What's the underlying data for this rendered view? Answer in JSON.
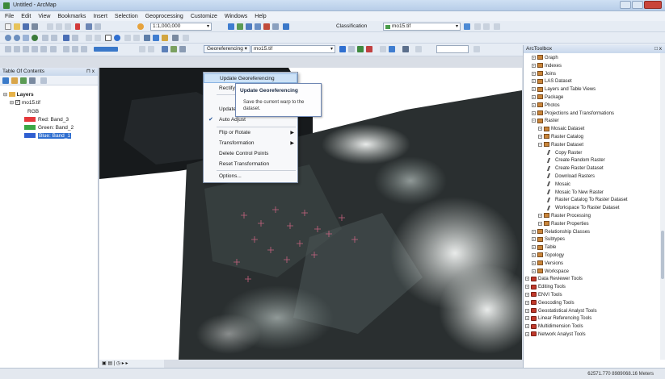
{
  "window": {
    "title": "Untitled - ArcMap"
  },
  "menu": [
    "File",
    "Edit",
    "View",
    "Bookmarks",
    "Insert",
    "Selection",
    "Geoprocessing",
    "Customize",
    "Windows",
    "Help"
  ],
  "standard_toolbar": {
    "scale": "1:1,000,000",
    "classification_label": "Classification",
    "classification_layer": "mo15.tif"
  },
  "georef_toolbar": {
    "menu_label": "Georeferencing",
    "layer": "mo15.tif"
  },
  "toc": {
    "title": "Table Of Contents",
    "layers_label": "Layers",
    "layer_name": "mo15.tif",
    "rgb_label": "RGB",
    "bands": [
      {
        "label": "Red:  Band_3",
        "color": "#e5383b"
      },
      {
        "label": "Green: Band_2",
        "color": "#3aa845"
      },
      {
        "label": "Blue:  Band_1",
        "color": "#2f5fd1"
      }
    ]
  },
  "georef_menu": {
    "items": [
      {
        "label": "Update Georeferencing",
        "highlighted": true
      },
      {
        "label": "Rectify..."
      },
      {
        "label": "Update"
      },
      {
        "label": "Auto Adjust",
        "checked": true
      },
      {
        "label": "Flip or Rotate",
        "submenu": true
      },
      {
        "label": "Transformation",
        "submenu": true
      },
      {
        "label": "Delete Control Points"
      },
      {
        "label": "Reset Transformation"
      },
      {
        "label": "Options..."
      }
    ],
    "tooltip": {
      "title": "Update Georeferencing",
      "body": "Save the current warp to the dataset."
    }
  },
  "toolbox": {
    "title": "ArcToolbox",
    "rows": [
      {
        "label": "Graph",
        "kind": "toolset",
        "level": 1
      },
      {
        "label": "Indexes",
        "kind": "toolset",
        "level": 1
      },
      {
        "label": "Joins",
        "kind": "toolset",
        "level": 1
      },
      {
        "label": "LAS Dataset",
        "kind": "toolset",
        "level": 1
      },
      {
        "label": "Layers and Table Views",
        "kind": "toolset",
        "level": 1
      },
      {
        "label": "Package",
        "kind": "toolset",
        "level": 1
      },
      {
        "label": "Photos",
        "kind": "toolset",
        "level": 1
      },
      {
        "label": "Projections and Transformations",
        "kind": "toolset",
        "level": 1
      },
      {
        "label": "Raster",
        "kind": "toolset",
        "level": 1,
        "expanded": true
      },
      {
        "label": "Mosaic Dataset",
        "kind": "toolset",
        "level": 2
      },
      {
        "label": "Raster Catalog",
        "kind": "toolset",
        "level": 2
      },
      {
        "label": "Raster Dataset",
        "kind": "toolset",
        "level": 2,
        "expanded": true
      },
      {
        "label": "Copy Raster",
        "kind": "tool",
        "level": 3
      },
      {
        "label": "Create Random Raster",
        "kind": "tool",
        "level": 3
      },
      {
        "label": "Create Raster Dataset",
        "kind": "tool",
        "level": 3
      },
      {
        "label": "Download Rasters",
        "kind": "tool",
        "level": 3
      },
      {
        "label": "Mosaic",
        "kind": "tool",
        "level": 3
      },
      {
        "label": "Mosaic To New Raster",
        "kind": "tool",
        "level": 3
      },
      {
        "label": "Raster Catalog To Raster Dataset",
        "kind": "tool",
        "level": 3
      },
      {
        "label": "Workspace To Raster Dataset",
        "kind": "tool",
        "level": 3
      },
      {
        "label": "Raster Processing",
        "kind": "toolset",
        "level": 2
      },
      {
        "label": "Raster Properties",
        "kind": "toolset",
        "level": 2
      },
      {
        "label": "Relationship Classes",
        "kind": "toolset",
        "level": 1
      },
      {
        "label": "Subtypes",
        "kind": "toolset",
        "level": 1
      },
      {
        "label": "Table",
        "kind": "toolset",
        "level": 1
      },
      {
        "label": "Topology",
        "kind": "toolset",
        "level": 1
      },
      {
        "label": "Versions",
        "kind": "toolset",
        "level": 1
      },
      {
        "label": "Workspace",
        "kind": "toolset",
        "level": 1
      },
      {
        "label": "Data Reviewer Tools",
        "kind": "toolbox",
        "level": 0
      },
      {
        "label": "Editing Tools",
        "kind": "toolbox",
        "level": 0
      },
      {
        "label": "ENVI Tools",
        "kind": "toolbox",
        "level": 0
      },
      {
        "label": "Geocoding Tools",
        "kind": "toolbox",
        "level": 0
      },
      {
        "label": "Geostatistical Analyst Tools",
        "kind": "toolbox",
        "level": 0
      },
      {
        "label": "Linear Referencing Tools",
        "kind": "toolbox",
        "level": 0
      },
      {
        "label": "Multidimension Tools",
        "kind": "toolbox",
        "level": 0
      },
      {
        "label": "Network Analyst Tools",
        "kind": "toolbox",
        "level": 0
      }
    ]
  },
  "status": {
    "coordinates": "62571.770  8989068.16 Meters"
  }
}
